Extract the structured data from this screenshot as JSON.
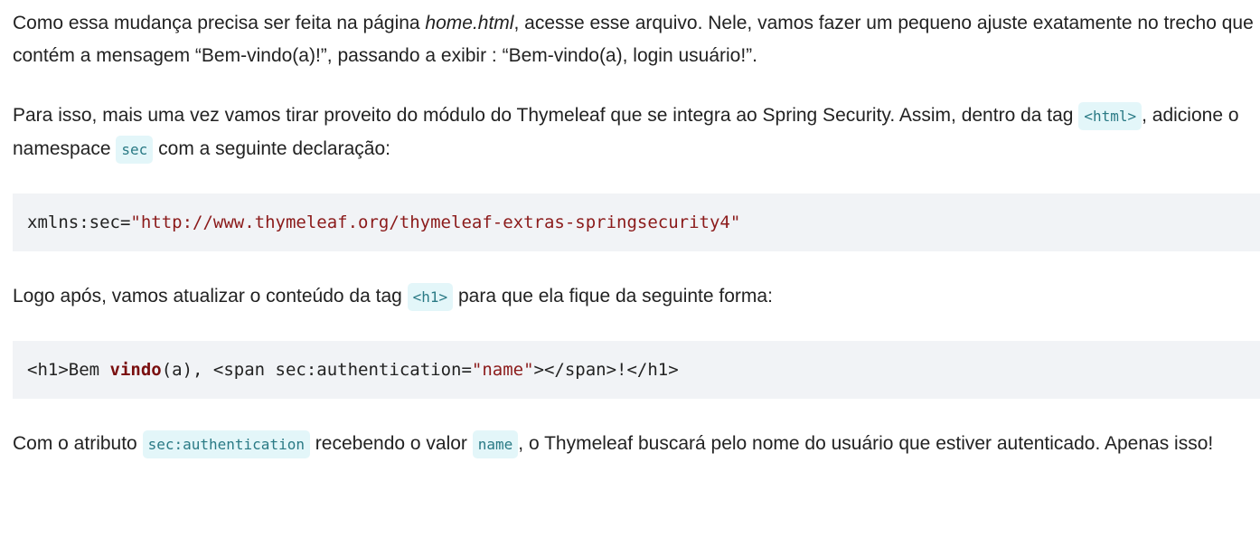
{
  "p1": {
    "t1": "Como essa mudança precisa ser feita na página ",
    "em": "home.html",
    "t2": ", acesse esse arquivo. Nele, vamos fazer um pequeno ajuste exatamente no trecho que contém a mensagem “Bem-vindo(a)!”, passando a exibir : “Bem-vindo(a), login usuário!”."
  },
  "p2": {
    "t1": "Para isso, mais uma vez vamos tirar proveito do módulo do Thymeleaf que se integra ao Spring Security. Assim, dentro da tag ",
    "code1": "<html>",
    "t2": ", adicione o namespace ",
    "code2": "sec",
    "t3": " com a seguinte declaração:"
  },
  "code1": {
    "attr": "xmlns:sec=",
    "value": "\"http://www.thymeleaf.org/thymeleaf-extras-springsecurity4\""
  },
  "p3": {
    "t1": "Logo após, vamos atualizar o conteúdo da tag ",
    "code": "<h1>",
    "t2": " para que ela fique da seguinte forma:"
  },
  "code2": {
    "part1": "<h1>Bem ",
    "kw": "vindo",
    "part2": "(a), <span sec:authentication=",
    "str": "\"name\"",
    "part3": "></span>!</h1>"
  },
  "p4": {
    "t1": "Com o atributo ",
    "code1": "sec:authentication",
    "t2": " recebendo o valor ",
    "code2": "name",
    "t3": ", o Thymeleaf buscará pelo nome do usuário que estiver autenticado. Apenas isso!"
  }
}
